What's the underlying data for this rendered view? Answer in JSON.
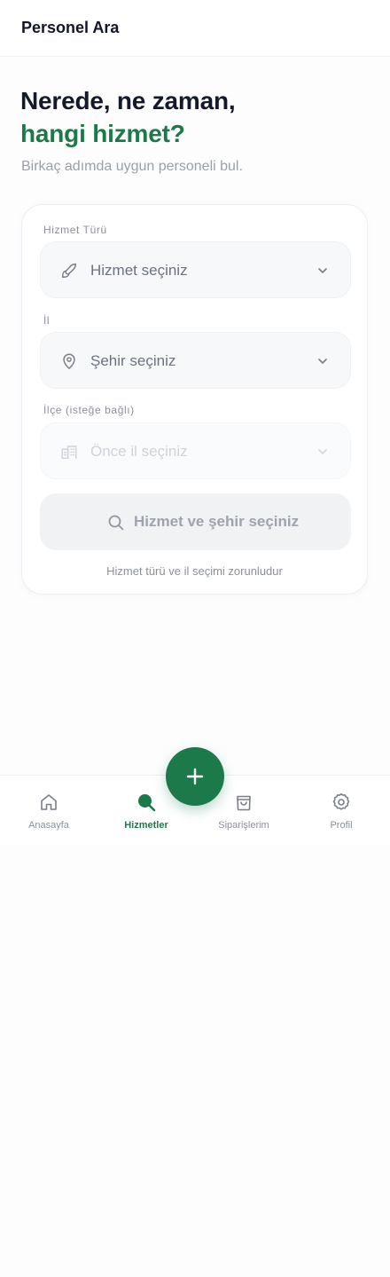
{
  "header": {
    "title": "Personel Ara"
  },
  "hero": {
    "line1": "Nerede, ne zaman,",
    "line2": "hangi hizmet?",
    "subtitle": "Birkaç adımda uygun personeli bul."
  },
  "form": {
    "service": {
      "label": "Hizmet Türü",
      "value": "Hizmet seçiniz",
      "icon": "brush-icon"
    },
    "city": {
      "label": "İl",
      "value": "Şehir seçiniz",
      "icon": "map-pin-icon"
    },
    "district": {
      "label": "İlçe (isteğe bağlı)",
      "value": "Önce il seçiniz",
      "icon": "building-icon"
    },
    "search_button": "Hizmet ve şehir seçiniz",
    "hint": "Hizmet türü ve il seçimi zorunludur"
  },
  "nav": {
    "items": [
      {
        "label": "Anasayfa",
        "icon": "home-icon"
      },
      {
        "label": "Hizmetler",
        "icon": "search-icon"
      },
      {
        "label": "Siparişlerim",
        "icon": "shopping-bag-icon"
      },
      {
        "label": "Profil",
        "icon": "gear-icon"
      }
    ],
    "active": "Hizmetler"
  },
  "fab": {
    "icon": "plus-icon"
  },
  "colors": {
    "accent": "#1c7a4a",
    "text_dark": "#151a2b",
    "text_muted": "#8b909a"
  }
}
